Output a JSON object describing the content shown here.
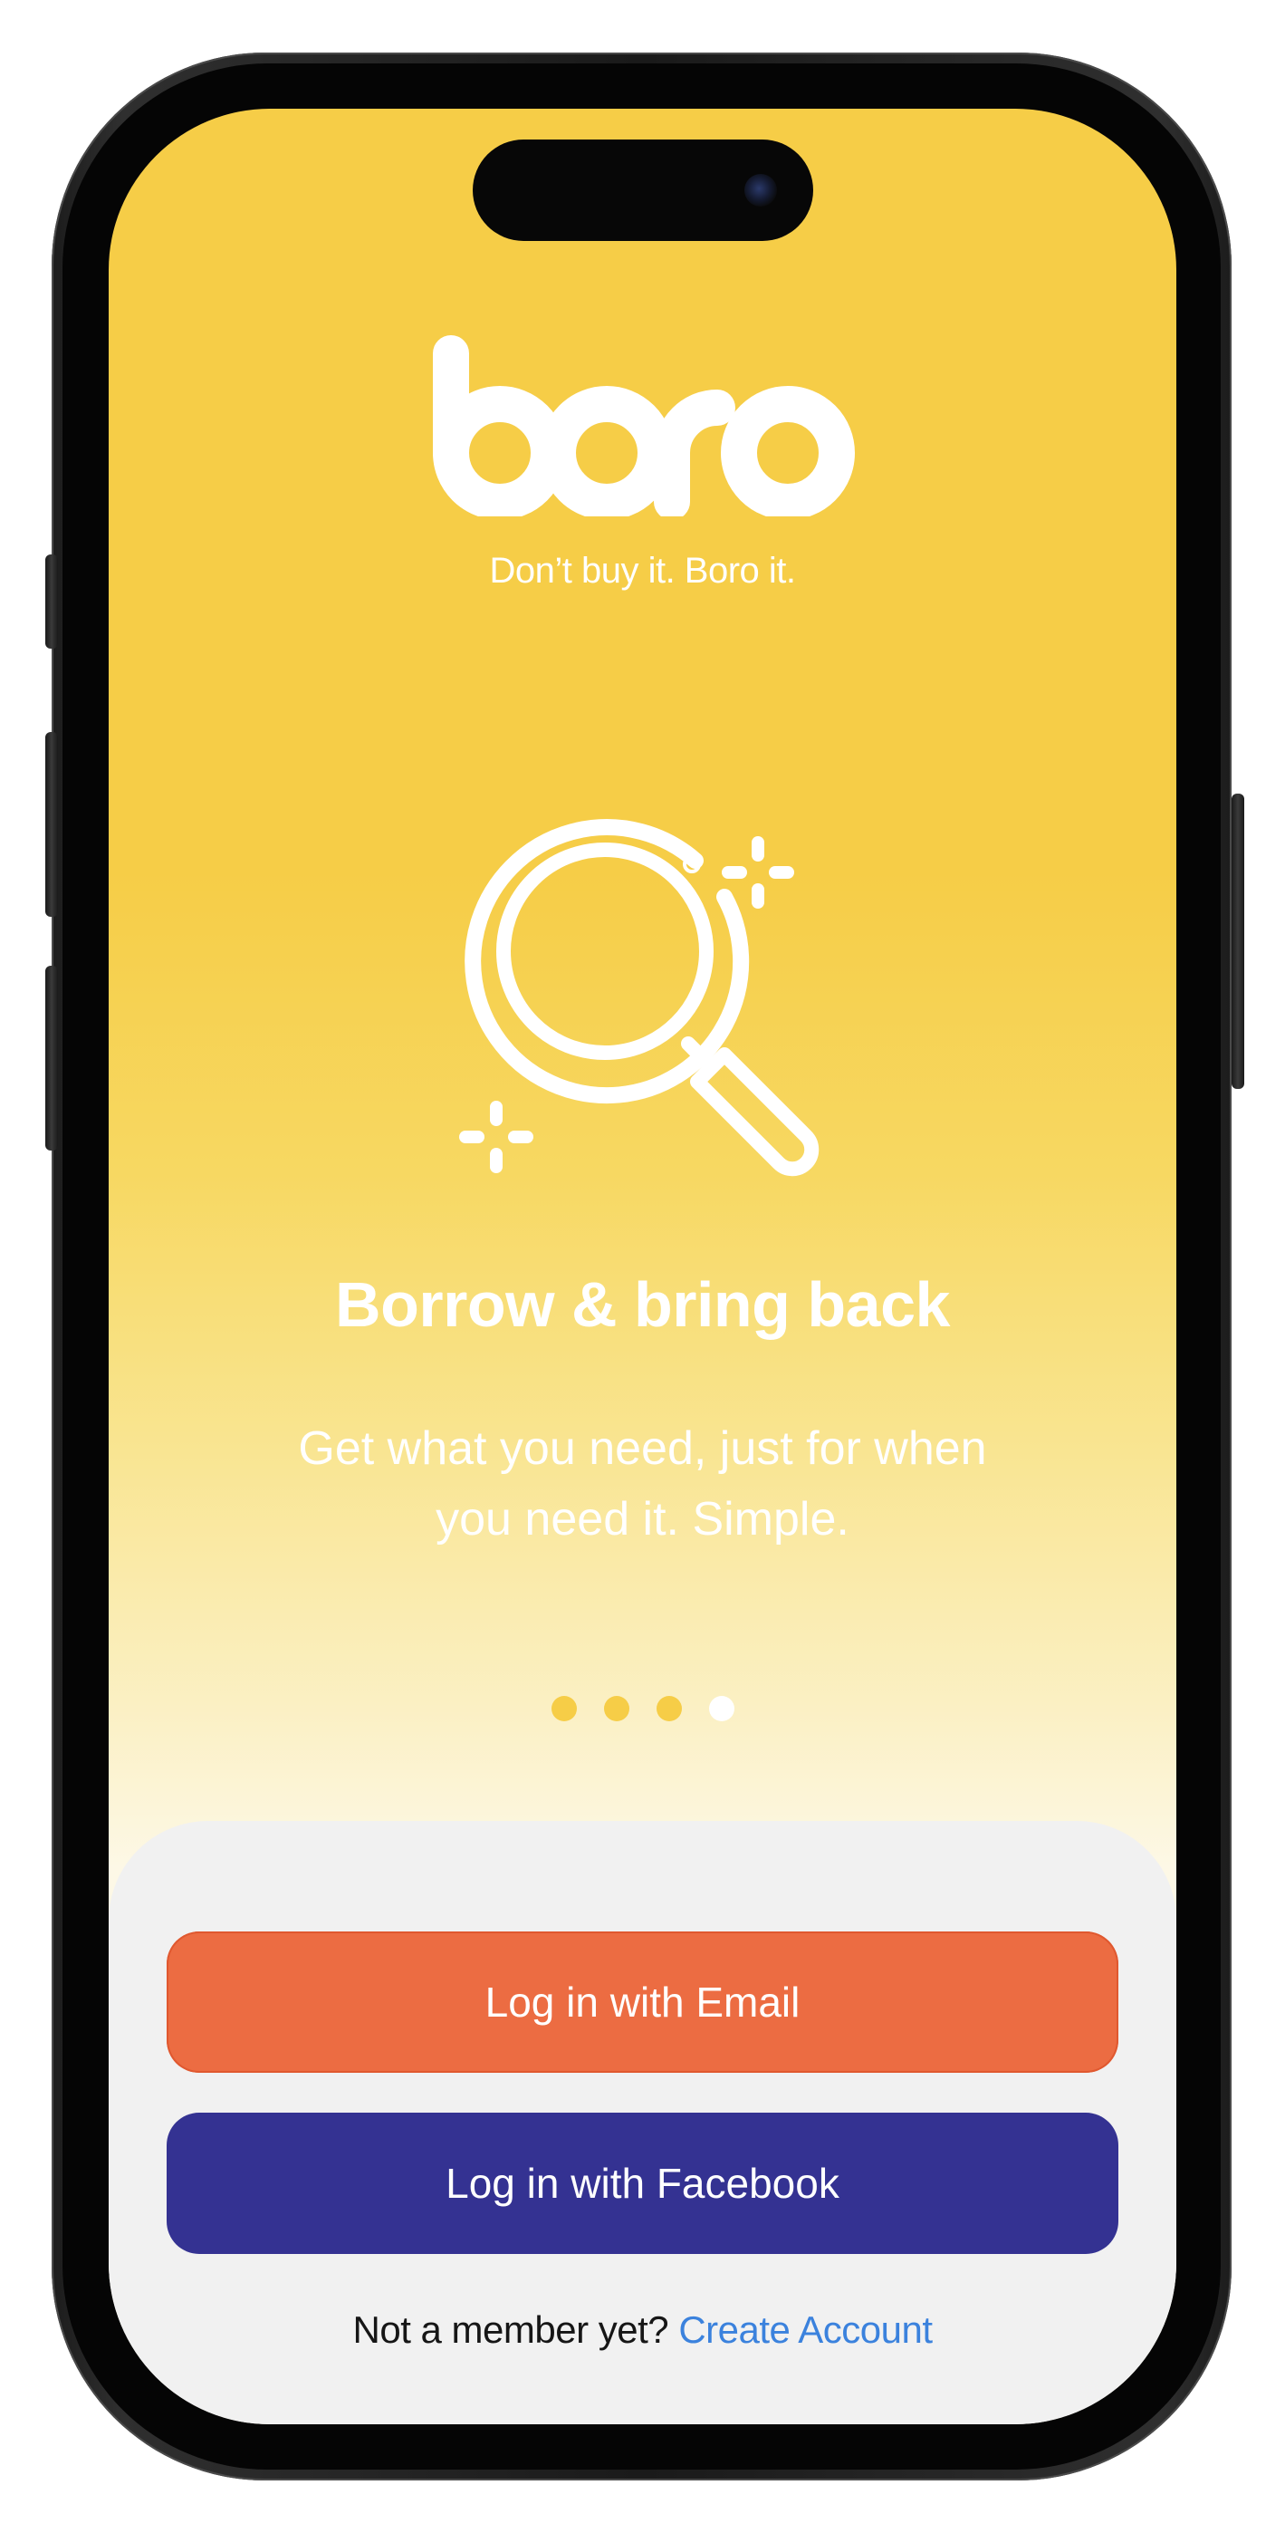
{
  "app": {
    "logo_text": "boro",
    "tagline": "Don’t buy it. Boro it."
  },
  "onboarding": {
    "illustration_icon": "magnifying-glass-sparkles-icon",
    "headline": "Borrow & bring back",
    "description": "Get what you need, just for when you need it. Simple.",
    "pager": {
      "total": 4,
      "active_index": 3
    }
  },
  "actions": {
    "email_login_label": "Log in with Email",
    "facebook_login_label": "Log in with Facebook"
  },
  "footer": {
    "prompt_text": "Not a member yet?",
    "create_account_label": "Create Account"
  },
  "colors": {
    "brand_yellow": "#f6cd47",
    "email_button": "#ec6c42",
    "facebook_button": "#343292",
    "link": "#3b82dd",
    "panel_background": "#f1f1f1"
  }
}
